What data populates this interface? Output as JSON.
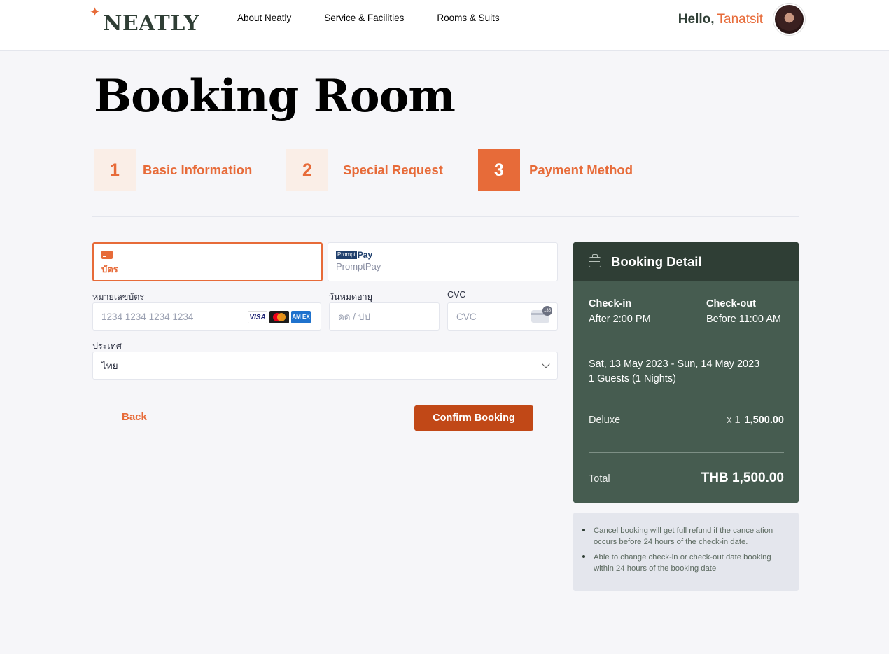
{
  "nav": {
    "logo": "NEATLY",
    "links": [
      "About Neatly",
      "Service & Facilities",
      "Rooms & Suits"
    ],
    "hello": "Hello,",
    "username": "Tanatsit"
  },
  "page_title": "Booking Room",
  "steps": [
    {
      "num": "1",
      "label": "Basic Information"
    },
    {
      "num": "2",
      "label": "Special Request"
    },
    {
      "num": "3",
      "label": "Payment Method"
    }
  ],
  "payment": {
    "card_tab_label": "บัตร",
    "promptpay_logo_box": "Prompt",
    "promptpay_logo_text": "Pay",
    "promptpay_tab_label": "PromptPay",
    "card_number_label": "หมายเลขบัตร",
    "card_number_placeholder": "1234 1234 1234 1234",
    "expiry_label": "วันหมดอายุ",
    "expiry_placeholder": "ดด / ปป",
    "cvc_label": "CVC",
    "cvc_placeholder": "CVC",
    "country_label": "ประเทศ",
    "country_value": "ไทย",
    "brands": {
      "visa": "VISA",
      "amex": "AM EX"
    }
  },
  "actions": {
    "back": "Back",
    "confirm": "Confirm Booking"
  },
  "booking_detail": {
    "title": "Booking Detail",
    "checkin_label": "Check-in",
    "checkin_value": "After 2:00 PM",
    "checkout_label": "Check-out",
    "checkout_value": "Before 11:00 AM",
    "dates": "Sat, 13 May 2023 - Sun, 14 May 2023",
    "guests": "1 Guests (1 Nights)",
    "room": "Deluxe",
    "qty": "x 1",
    "price": "1,500.00",
    "total_label": "Total",
    "total_value": "THB 1,500.00"
  },
  "notes": [
    "Cancel booking will get full refund if the cancelation occurs before 24 hours of the check-in date.",
    "Able to change check-in or check-out date booking within 24 hours of the booking date"
  ],
  "colors": {
    "accent": "#e76b39",
    "confirm_button": "#c14817",
    "detail_bg": "#465c50",
    "detail_header": "#2f3e35"
  }
}
